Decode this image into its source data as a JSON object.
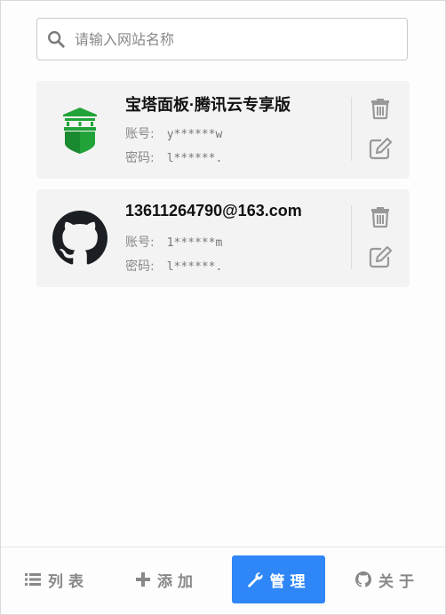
{
  "search": {
    "placeholder": "请输入网站名称",
    "value": ""
  },
  "labels": {
    "account": "账号:",
    "password": "密码:"
  },
  "entries": [
    {
      "name": "宝塔面板·腾讯云专享版",
      "account": "y******w",
      "password": "l******.",
      "logo": "bt-panel-logo"
    },
    {
      "name": "13611264790@163.com",
      "account": "1******m",
      "password": "l******.",
      "logo": "github-logo"
    }
  ],
  "nav": {
    "list": "列表",
    "add": "添加",
    "manage": "管理",
    "about": "关于"
  },
  "colors": {
    "accent": "#2f86f6",
    "card_bg": "#f3f3f3",
    "bt_green": "#22a33a"
  }
}
